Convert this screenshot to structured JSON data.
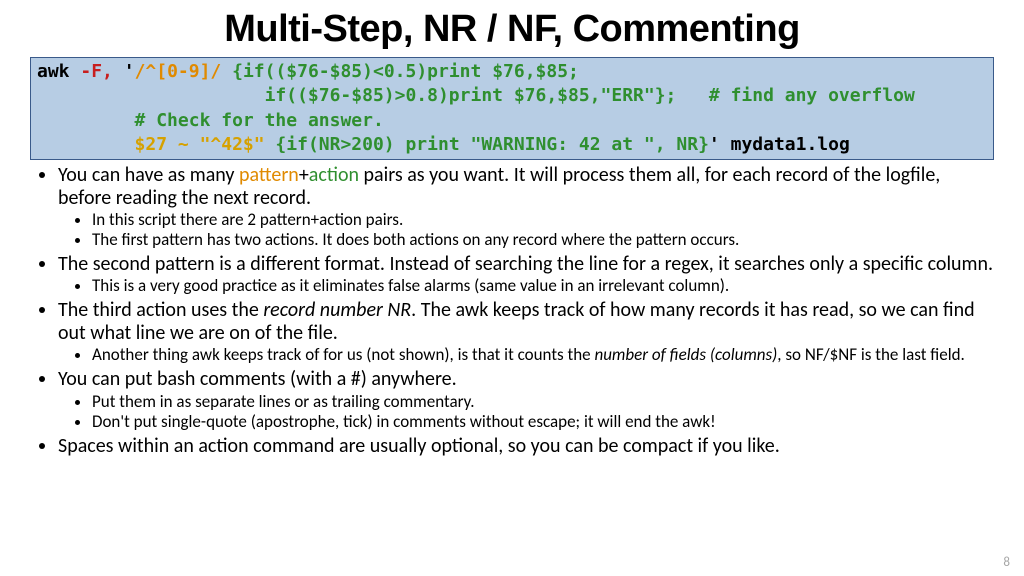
{
  "title": "Multi-Step, NR / NF, Commenting",
  "code": {
    "l1_awk": "awk ",
    "l1_flag": "-F,",
    "l1_q": " '",
    "l1_pat": "/^[0-9]/",
    "l1_act": " {if(($76-$85)<0.5)print $76,$85;",
    "l2_pad": "                     ",
    "l2_act": "if(($76-$85)>0.8)print $76,$85,\"ERR\"};   # find any overflow",
    "l3_pad": "         ",
    "l3_cmt": "# Check for the answer.",
    "l4_pad": "         ",
    "l4_pat": "$27 ~ \"^42$\"",
    "l4_act": " {if(NR>200) print \"WARNING: 42 at \", NR}",
    "l4_q": "'",
    "l4_file": " mydata1.log"
  },
  "b1": {
    "pre": "You can have as many ",
    "patt": "pattern",
    "plus": "+",
    "act": "action",
    "post": " pairs as you want.  It will process them all, for each record of the logfile, before reading the next record.",
    "s1": "In this script there are 2 pattern+action pairs.",
    "s2": "The first pattern has two actions.  It does both actions on any record where the pattern occurs."
  },
  "b2": {
    "text": "The second pattern is a different format.  Instead of searching the line for a regex, it searches only a specific column.",
    "s1": "This is a very good practice as it eliminates false alarms (same value in an irrelevant column)."
  },
  "b3": {
    "pre": "The third action uses the ",
    "em": "record number NR",
    "post": ".  The awk keeps track of how many records it has read, so we can find out what line we are on of the file.",
    "s1_pre": "Another thing awk keeps track of for us (not shown), is that it counts the ",
    "s1_em": "number of fields (columns)",
    "s1_post": ", so NF/$NF is the last field."
  },
  "b4": {
    "text": "You can put bash comments (with a #) anywhere.",
    "s1": "Put them in as separate lines or as trailing commentary.",
    "s2": "Don't put single-quote (apostrophe, tick) in comments without escape; it will end the awk!"
  },
  "b5": {
    "text": "Spaces within an action command are usually optional, so you can be compact if you like."
  },
  "page": "8"
}
